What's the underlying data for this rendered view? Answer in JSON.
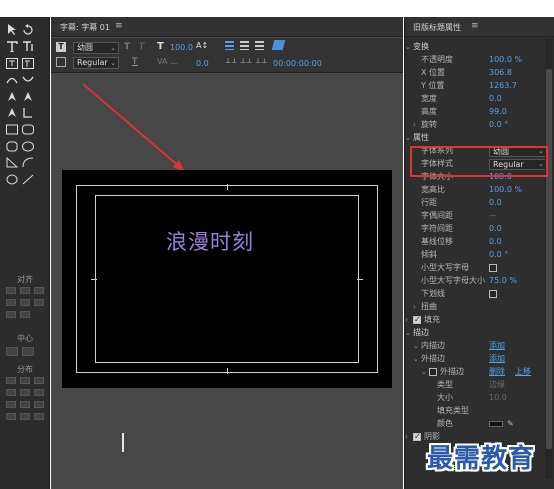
{
  "panel": {
    "title": "字幕: 字幕 01",
    "menu_glyph": "≡"
  },
  "toolbar": {
    "font_family": "幼圆",
    "font_style": "Regular",
    "font_size": "100.0",
    "kerning": "0.0",
    "leading_value": "0.0",
    "time": "00:00:00:00"
  },
  "canvas": {
    "title_text": "浪漫时刻"
  },
  "left_tools": {
    "align_label": "对齐",
    "center_label": "中心",
    "distribute_label": "分布"
  },
  "props": {
    "title": "旧版标题属性",
    "menu_glyph": "≡",
    "rows": [
      {
        "label": "变换",
        "type": "section"
      },
      {
        "label": "不透明度",
        "value": "100.0 %"
      },
      {
        "label": "X 位置",
        "value": "306.8"
      },
      {
        "label": "Y 位置",
        "value": "1263.7"
      },
      {
        "label": "宽度",
        "value": "0.0"
      },
      {
        "label": "高度",
        "value": "99.0"
      },
      {
        "label": "旋转",
        "value": "0.0 °",
        "twisty": true
      },
      {
        "label": "属性",
        "type": "section"
      },
      {
        "label": "字体系列",
        "dropdown": "幼圆"
      },
      {
        "label": "字体样式",
        "dropdown": "Regular"
      },
      {
        "label": "字体大小",
        "value": "100.0"
      },
      {
        "label": "宽高比",
        "value": "100.0 %"
      },
      {
        "label": "行距",
        "value": "0.0"
      },
      {
        "label": "字偶间距",
        "value": "—",
        "gray": true
      },
      {
        "label": "字符间距",
        "value": "0.0"
      },
      {
        "label": "基线位移",
        "value": "0.0"
      },
      {
        "label": "倾斜",
        "value": "0.0 °"
      },
      {
        "label": "小型大写字母",
        "checkbox": false
      },
      {
        "label": "小型大写字母大小",
        "value": "75.0 %"
      },
      {
        "label": "下划线",
        "checkbox": false
      },
      {
        "label": "扭曲",
        "twisty": true
      },
      {
        "label": "填充",
        "section_check": true
      },
      {
        "label": "描边",
        "type": "section"
      },
      {
        "label": "内描边",
        "link": "添加"
      },
      {
        "label": "外描边",
        "link": "添加"
      },
      {
        "label": "外描边",
        "link": "删除",
        "link2": "上移",
        "sub_check": true
      },
      {
        "label": "类型",
        "value": "边缘",
        "gray": true
      },
      {
        "label": "大小",
        "value": "10.0",
        "gray": true
      },
      {
        "label": "填充类型",
        "value": "",
        "gray": true
      },
      {
        "label": "颜色",
        "swatch": true
      },
      {
        "label": "阴影",
        "section_check": true
      }
    ]
  },
  "watermark": "最需教育",
  "colors": {
    "accent_blue": "#5aa0e6",
    "highlight_red": "#e0343a",
    "title_purple": "#9b7fd8",
    "watermark_blue": "#2d5aa8"
  }
}
